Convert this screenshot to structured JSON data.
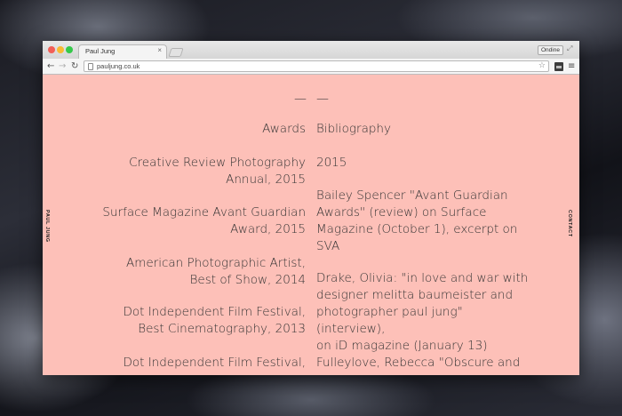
{
  "browser": {
    "tab_title": "Paul Jung",
    "tab_close": "×",
    "profile_label": "Ondine",
    "url": "pauljung.co.uk"
  },
  "icons": {
    "back": "←",
    "forward": "→",
    "reload": "↻",
    "star": "☆",
    "menu": "≡",
    "resize": "⤢"
  },
  "page": {
    "side_left": "PAUL JUNG",
    "side_right": "CONTACT",
    "dash": "—",
    "left_column": [
      {
        "id": "awards-heading",
        "lines": [
          "Awards"
        ]
      },
      {
        "id": "award-1",
        "lines": [
          "Creative Review Photography",
          "Annual, 2015"
        ]
      },
      {
        "id": "award-2",
        "lines": [
          "Surface Magazine Avant Guardian",
          "Award, 2015"
        ]
      },
      {
        "id": "award-3",
        "lines": [
          "American Photographic Artist,",
          "Best of Show, 2014"
        ]
      },
      {
        "id": "award-4",
        "lines": [
          "Dot Independent Film Festival,",
          "Best Cinematography, 2013"
        ]
      },
      {
        "id": "award-5",
        "lines": [
          "Dot Independent Film Festival,"
        ]
      }
    ],
    "right_column": [
      {
        "id": "bibliography-heading",
        "lines": [
          "Bibliography"
        ]
      },
      {
        "id": "bib-year",
        "lines": [
          "2015"
        ]
      },
      {
        "id": "bib-1",
        "lines": [
          "Bailey Spencer \"Avant Guardian",
          "Awards\" (review) on Surface",
          "Magazine (October 1), excerpt on",
          "SVA"
        ]
      },
      {
        "id": "bib-2",
        "lines": [
          "Drake, Olivia: \"in love and war with",
          "designer melitta baumeister and",
          "photographer paul jung\" (interview),",
          "on iD magazine (January 13)"
        ]
      },
      {
        "id": "bib-3",
        "lines": [
          "Fulleylove, Rebecca \"Obscure and"
        ]
      }
    ],
    "colors": {
      "page_background": "#fdc0b8",
      "text": "#333333"
    }
  }
}
